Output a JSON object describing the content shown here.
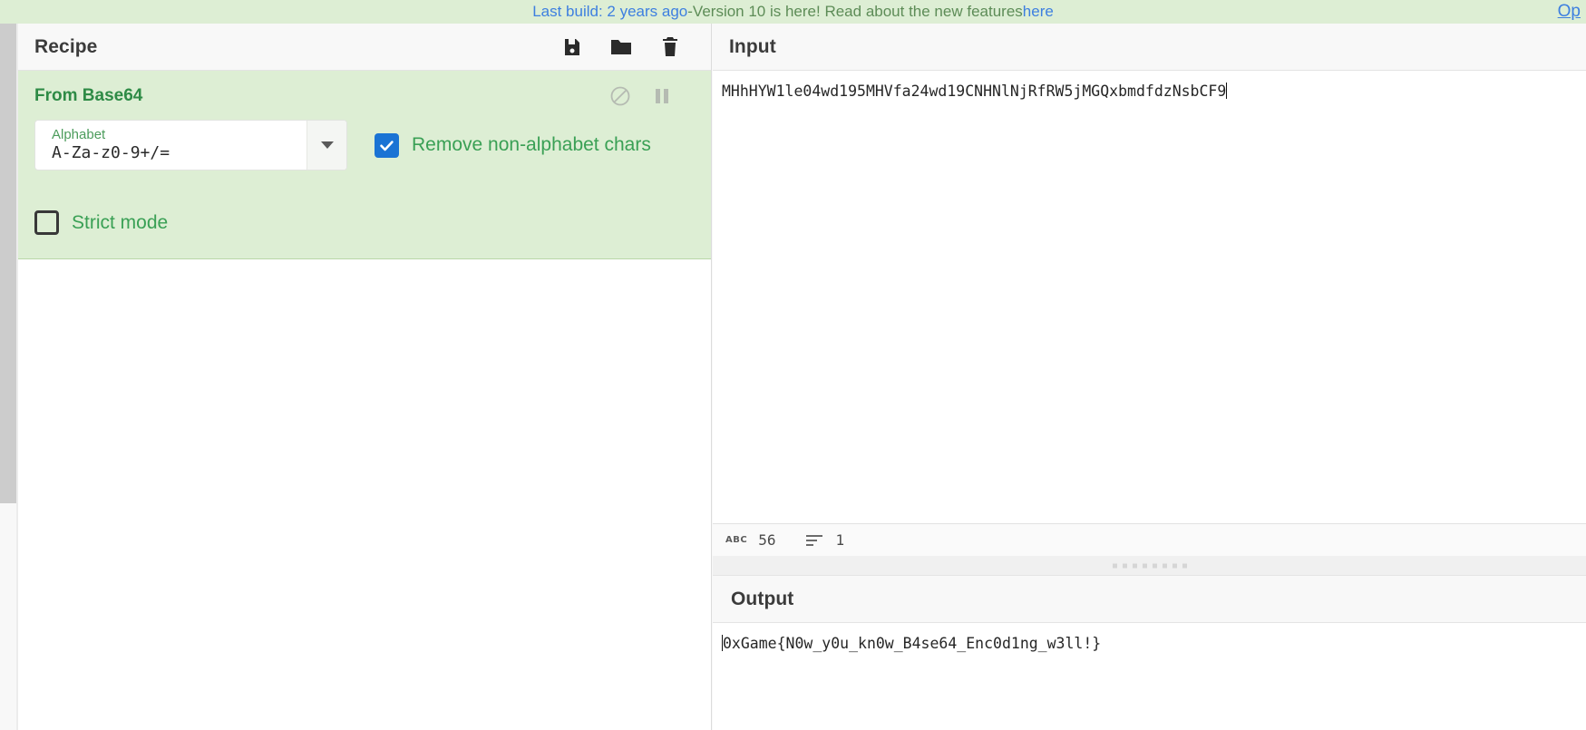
{
  "banner": {
    "link_text": "Last build: 2 years ago",
    "separator": " - ",
    "message": "Version 10 is here! Read about the new features ",
    "link2_text": "here",
    "options_label": "Op"
  },
  "recipe": {
    "title": "Recipe",
    "actions": [
      {
        "name": "save-recipe",
        "label": "Save recipe",
        "icon": "floppy-disk-icon"
      },
      {
        "name": "load-recipe",
        "label": "Load recipe",
        "icon": "folder-icon"
      },
      {
        "name": "clear-recipe",
        "label": "Clear recipe",
        "icon": "trash-icon"
      }
    ],
    "operations": [
      {
        "title": "From Base64",
        "disable_icon": "circle-slash-icon",
        "breakpoint_icon": "pause-icon",
        "args": {
          "alphabet_label": "Alphabet",
          "alphabet_value": "A-Za-z0-9+/=",
          "remove_non_alphabet_label": "Remove non-alphabet chars",
          "remove_non_alphabet_checked": true,
          "strict_mode_label": "Strict mode",
          "strict_mode_checked": false
        }
      }
    ]
  },
  "input": {
    "title": "Input",
    "value": "MHhHYW1le04wd195MHVfa24wd19CNHNlNjRfRW5jMGQxbmdfdzNsbCF9",
    "status": {
      "length_icon": "abc-icon",
      "length": "56",
      "lines_icon": "lines-icon",
      "lines": "1"
    }
  },
  "output": {
    "title": "Output",
    "value": "0xGame{N0w_y0u_kn0w_B4se64_Enc0d1ng_w3ll!}"
  },
  "colors": {
    "banner_bg": "#ddeed4",
    "operation_bg": "#ddeed4",
    "operation_title": "#2e8b46",
    "checkbox_checked": "#1a73d4",
    "link": "#3d7fe0"
  }
}
